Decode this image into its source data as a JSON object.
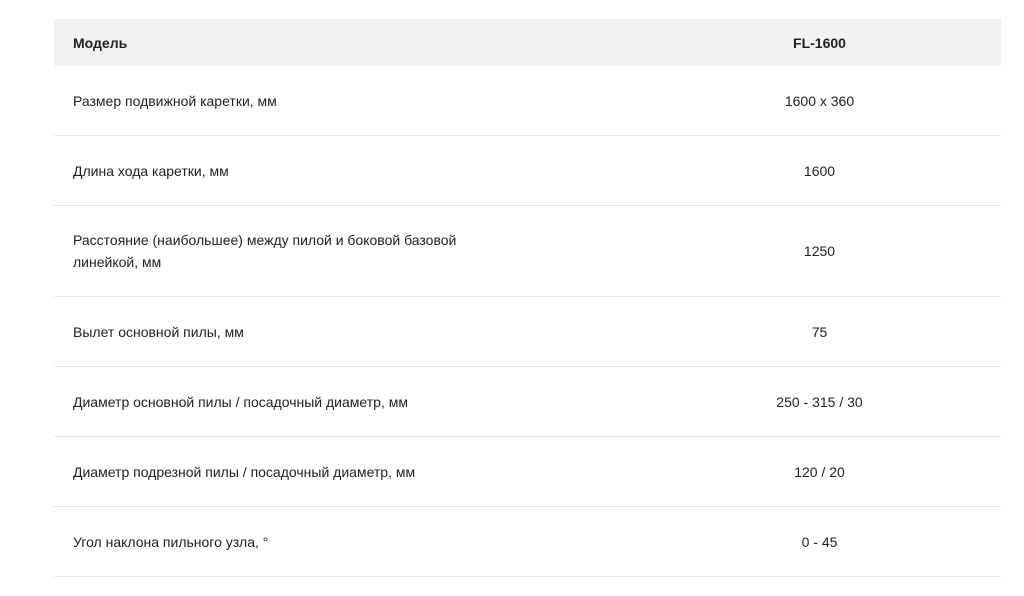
{
  "table": {
    "header": {
      "label": "Модель",
      "value": "FL-1600"
    },
    "rows": [
      {
        "label": "Размер подвижной каретки, мм",
        "value": "1600 x 360"
      },
      {
        "label": "Длина хода каретки, мм",
        "value": "1600"
      },
      {
        "label": "Расстояние (наибольшее) между пилой и боковой базовой линейкой, мм",
        "value": "1250"
      },
      {
        "label": "Вылет основной пилы, мм",
        "value": "75"
      },
      {
        "label": "Диаметр основной пилы / посадочный диаметр, мм",
        "value": "250 - 315 / 30"
      },
      {
        "label": "Диаметр подрезной пилы / посадочный диаметр, мм",
        "value": "120 / 20"
      },
      {
        "label": "Угол наклона пильного узла, °",
        "value": "0 - 45"
      }
    ]
  }
}
